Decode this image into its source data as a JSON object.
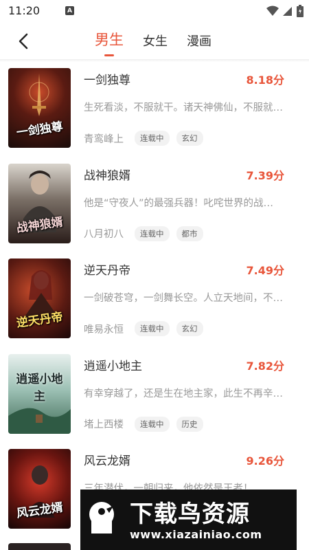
{
  "status_bar": {
    "time": "11:20",
    "notification_letter": "A",
    "icons": [
      "wifi-icon",
      "signal-icon",
      "battery-icon"
    ]
  },
  "header": {
    "back_icon": "chevron-left-icon",
    "tabs": [
      {
        "label": "男生",
        "active": true
      },
      {
        "label": "女生",
        "active": false
      },
      {
        "label": "漫画",
        "active": false
      }
    ]
  },
  "books": [
    {
      "title": "一剑独尊",
      "score": "8.18分",
      "description": "生死看淡，不服就干。诸天神佛仙，不服就干！",
      "author": "青鸾峰上",
      "status": "连载中",
      "genre": "玄幻",
      "cover_text": "一剑独尊"
    },
    {
      "title": "战神狼婿",
      "score": "7.39分",
      "description": "他是“守夜人”的最强兵器！叱咤世界的战神！",
      "author": "八月初八",
      "status": "连载中",
      "genre": "都市",
      "cover_text": "战神狼婿"
    },
    {
      "title": "逆天丹帝",
      "score": "7.49分",
      "description": "一剑破苍穹，一剑舞长空。人立天地间，不服就干！",
      "author": "唯易永恒",
      "status": "连载中",
      "genre": "玄幻",
      "cover_text": "逆天丹帝"
    },
    {
      "title": "逍遥小地主",
      "score": "7.82分",
      "description": "有幸穿越了，还是生在地主家，此生不再辛劳！",
      "author": "堵上西楼",
      "status": "连载中",
      "genre": "历史",
      "cover_text": "逍遥小地主"
    },
    {
      "title": "风云龙婿",
      "score": "9.26分",
      "description": "三年潜伏，一朝归来，他依然是王者！",
      "author": "",
      "status": "",
      "genre": "",
      "cover_text": "风云龙婿"
    }
  ],
  "watermark": {
    "title": "下载鸟资源",
    "url": "www.xiazainiao.com"
  },
  "colors": {
    "accent": "#e8553a",
    "text_primary": "#333333",
    "text_secondary": "#999999",
    "tag_bg": "#f2f2f2"
  }
}
